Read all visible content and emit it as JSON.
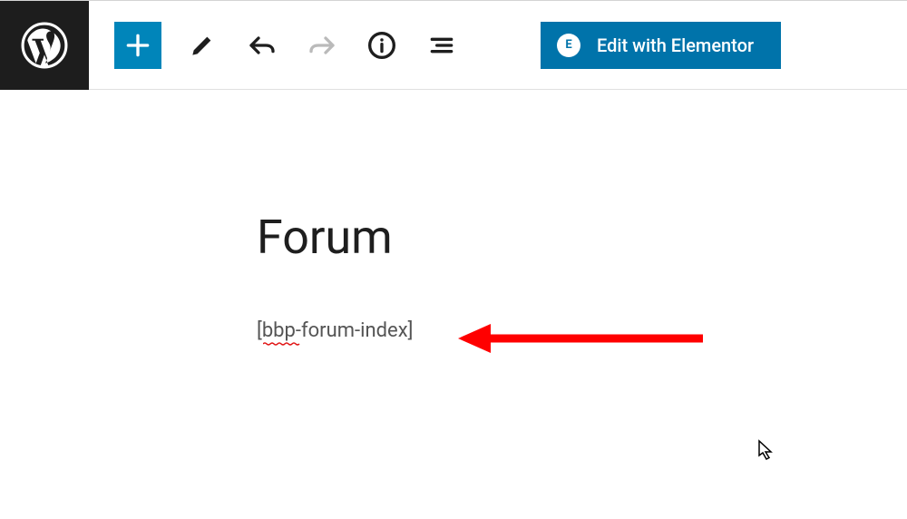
{
  "toolbar": {
    "elementor_label": "Edit with Elementor",
    "elementor_badge": "E"
  },
  "content": {
    "title": "Forum",
    "shortcode": "[bbp-forum-index]"
  }
}
